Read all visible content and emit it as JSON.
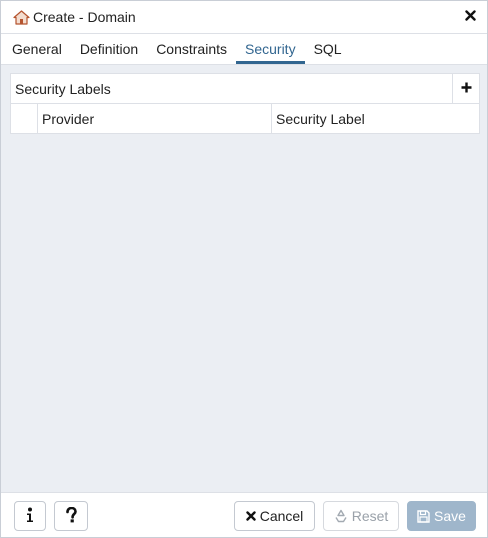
{
  "dialog": {
    "title": "Create - Domain",
    "title_icon": "domain-house-icon",
    "close_icon": "close-icon"
  },
  "tabs": [
    {
      "label": "General",
      "active": false
    },
    {
      "label": "Definition",
      "active": false
    },
    {
      "label": "Constraints",
      "active": false
    },
    {
      "label": "Security",
      "active": true
    },
    {
      "label": "SQL",
      "active": false
    }
  ],
  "security_labels": {
    "title": "Security Labels",
    "add_icon": "plus-icon",
    "columns": [
      "Provider",
      "Security Label"
    ],
    "rows": []
  },
  "footer": {
    "info_icon": "info-icon",
    "help_icon": "question-icon",
    "cancel_label": "Cancel",
    "reset_label": "Reset",
    "save_label": "Save"
  },
  "colors": {
    "accent": "#326690",
    "content_bg": "#ebeef3",
    "save_disabled_bg": "#9fb6cb"
  }
}
